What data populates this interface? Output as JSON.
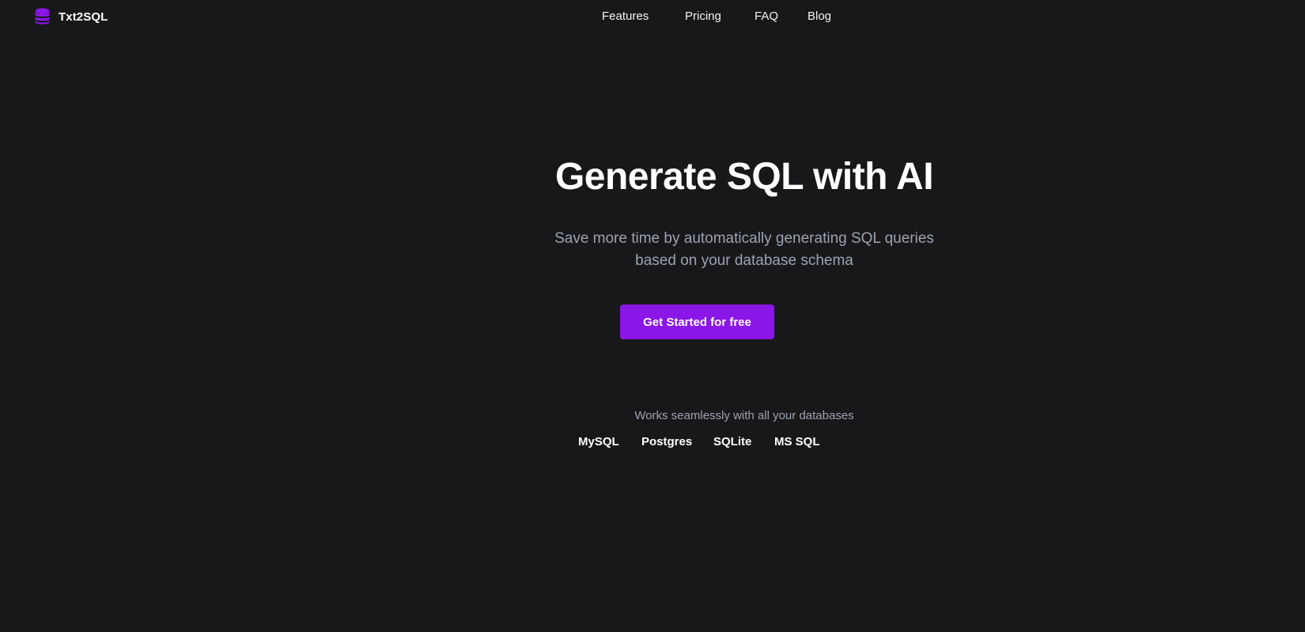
{
  "brand": {
    "name": "Txt2SQL",
    "icon": "database-icon",
    "accent_color": "#8b16e8"
  },
  "nav": {
    "items": [
      {
        "label": "Features"
      },
      {
        "label": "Pricing"
      },
      {
        "label": "FAQ"
      },
      {
        "label": "Blog"
      }
    ]
  },
  "hero": {
    "title": "Generate SQL with AI",
    "subtitle_line1": "Save more time by automatically generating SQL queries",
    "subtitle_line2": "based on your database schema",
    "cta_label": "Get Started for free"
  },
  "databases": {
    "caption": "Works seamlessly with all your databases",
    "items": [
      {
        "label": "MySQL"
      },
      {
        "label": "Postgres"
      },
      {
        "label": "SQLite"
      },
      {
        "label": "MS SQL"
      }
    ]
  },
  "colors": {
    "background": "#18181b",
    "muted_text": "#9ca3af",
    "cta_background": "#8b16e8"
  }
}
